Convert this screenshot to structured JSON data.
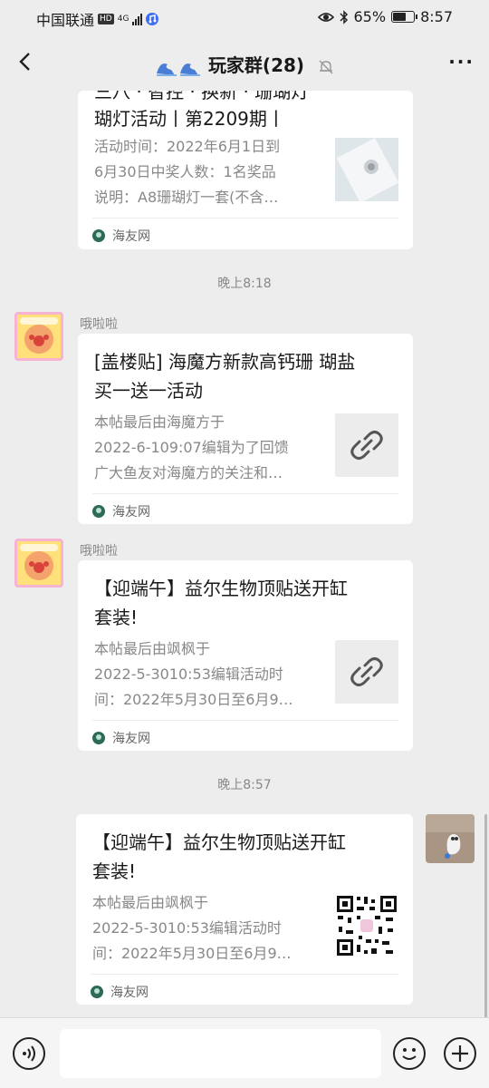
{
  "status_bar": {
    "carrier": "中国联通",
    "network_badge": "HD",
    "network_type": "4G",
    "battery": "65%",
    "time": "8:57",
    "icons": [
      "eye-icon",
      "bluetooth-icon",
      "battery-icon",
      "signal-icon",
      "music-icon"
    ]
  },
  "header": {
    "title": "玩家群(28)",
    "icons": [
      "back-icon",
      "mute-bell-icon",
      "more-icon"
    ]
  },
  "messages": [
    {
      "type": "card-partial",
      "title_partial": "三八 · 智控 · 换新 · 珊瑚灯",
      "title_line2": "瑚灯活动丨第2209期丨",
      "desc": [
        "活动时间：2022年6月1日到",
        "6月30日中奖人数：1名奖品",
        "说明：A8珊瑚灯一套(不含…"
      ],
      "source": "海友网"
    },
    {
      "type": "time",
      "text": "晚上8:18"
    },
    {
      "type": "card",
      "sender": "哦啦啦",
      "title": [
        "[盖楼贴] 海魔方新款高钙珊 瑚盐",
        "买一送一活动"
      ],
      "desc": [
        "本帖最后由海魔方于",
        "2022-6-109:07编辑为了回馈",
        "广大鱼友对海魔方的关注和…"
      ],
      "thumb": "link-icon",
      "source": "海友网"
    },
    {
      "type": "card",
      "sender": "哦啦啦",
      "title": [
        "【迎端午】益尔生物顶贴送开缸",
        "套装!"
      ],
      "desc": [
        "本帖最后由飒枫于",
        "2022-5-3010:53编辑活动时",
        "间：2022年5月30日至6月9…"
      ],
      "thumb": "link-icon",
      "source": "海友网"
    },
    {
      "type": "time",
      "text": "晚上8:57"
    },
    {
      "type": "card-self",
      "title": [
        "【迎端午】益尔生物顶贴送开缸",
        "套装!"
      ],
      "desc": [
        "本帖最后由飒枫于",
        "2022-5-3010:53编辑活动时",
        "间：2022年5月30日至6月9…"
      ],
      "thumb": "qr-code",
      "source": "海友网"
    }
  ],
  "input_bar": {
    "icons": [
      "voice-icon",
      "emoji-icon",
      "plus-icon"
    ]
  },
  "colors": {
    "background": "#ededed",
    "card": "#ffffff",
    "title_text": "#191919",
    "desc_text": "#888888",
    "source_icon": "#2d6a57"
  }
}
